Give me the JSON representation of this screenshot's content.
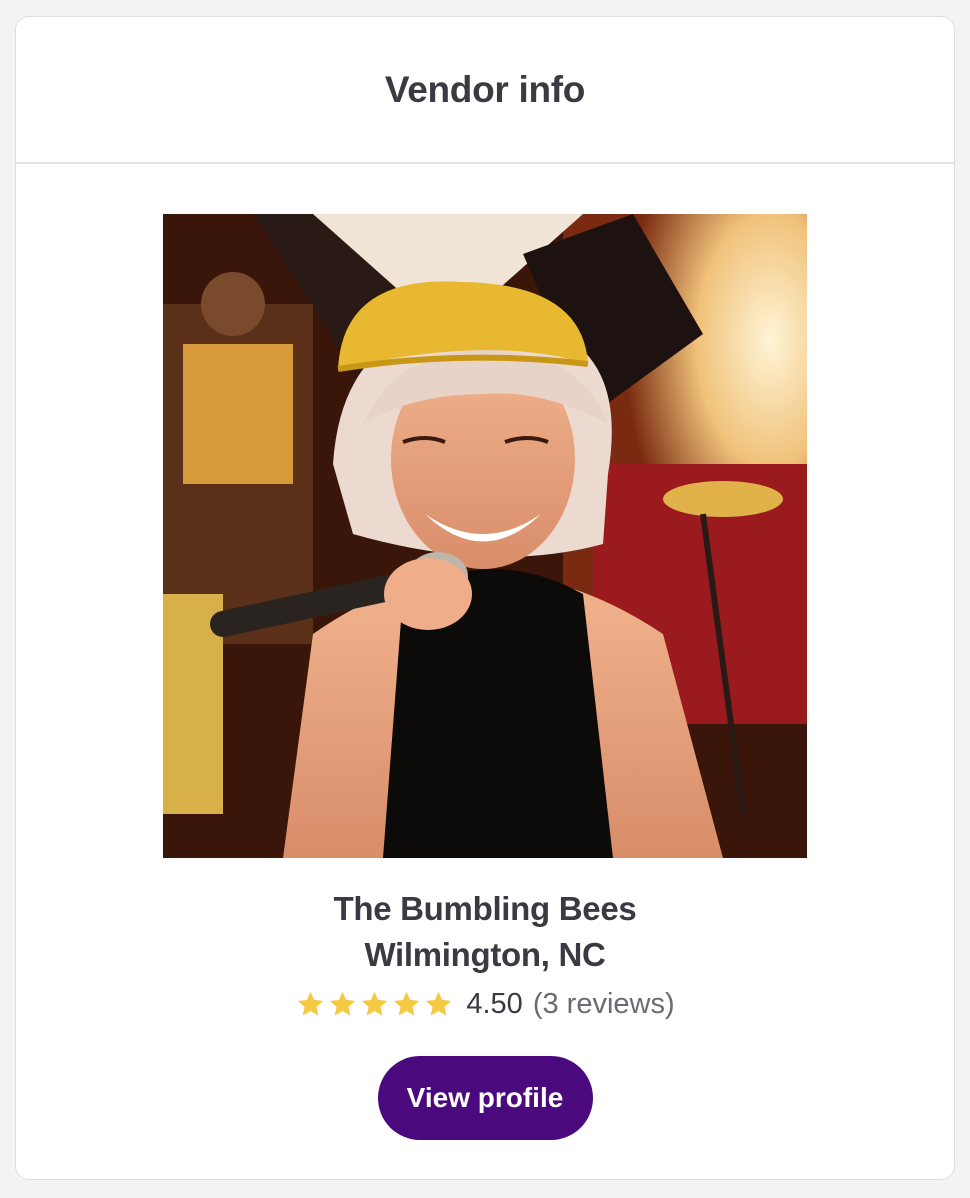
{
  "card": {
    "title": "Vendor info"
  },
  "vendor": {
    "name": "The Bumbling Bees",
    "location": "Wilmington, NC",
    "rating": {
      "stars": 5,
      "value": "4.50",
      "reviews": "(3 reviews)"
    },
    "button_label": "View profile"
  },
  "colors": {
    "accent": "#4a0a7d",
    "star": "#f6c945",
    "text": "#3a3a42",
    "muted": "#6b6b73"
  },
  "icons": {
    "star": "star-icon"
  }
}
